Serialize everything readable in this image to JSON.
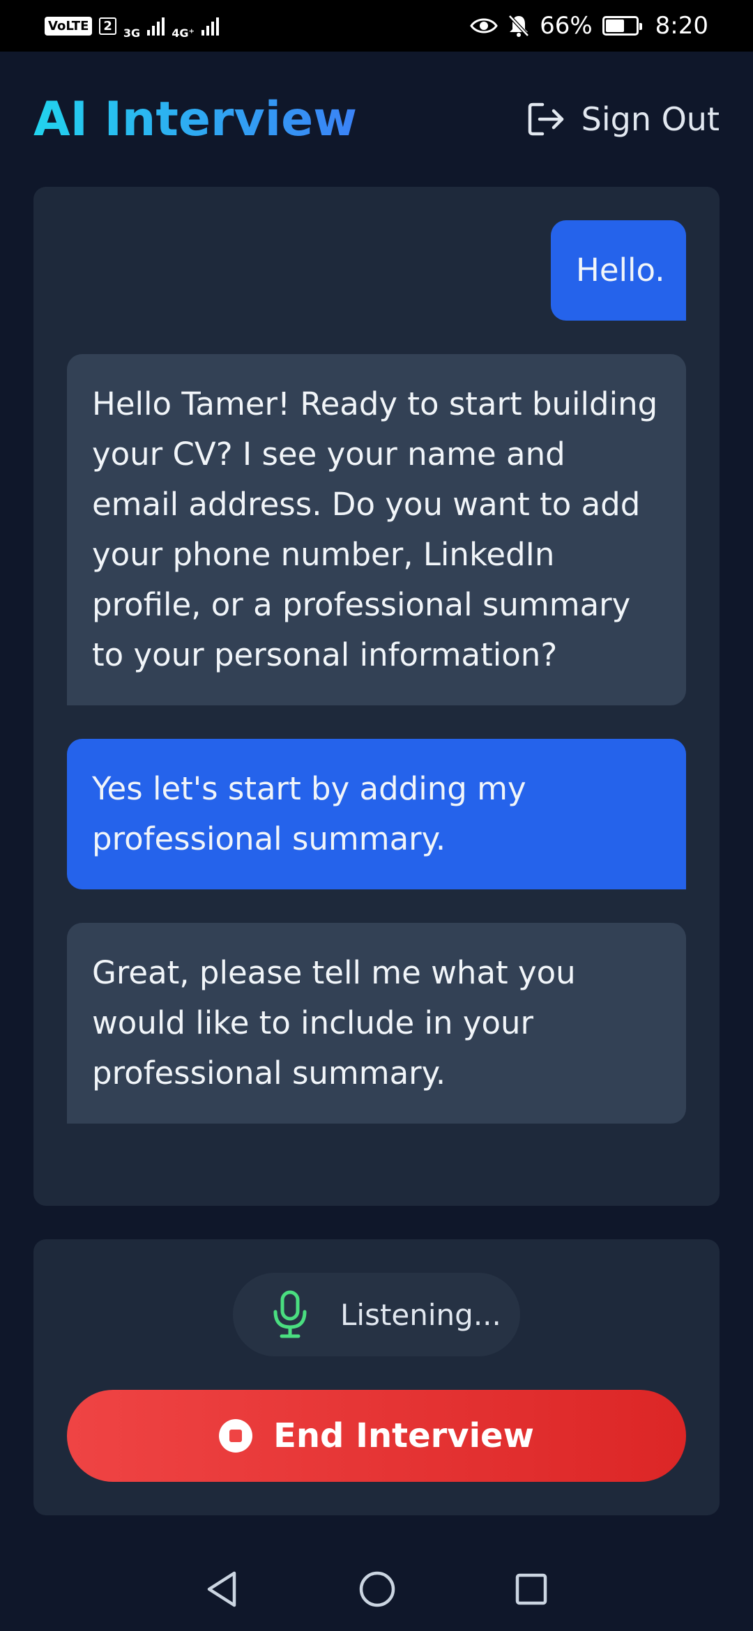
{
  "status_bar": {
    "volte": "VoLTE",
    "sim": "2",
    "net1": "3G",
    "net2": "4G⁺",
    "battery_percent": "66%",
    "battery_level": 0.66,
    "time": "8:20"
  },
  "header": {
    "title": "AI Interview",
    "sign_out_label": "Sign Out"
  },
  "chat": {
    "messages": [
      {
        "role": "user",
        "text": "Hello."
      },
      {
        "role": "ai",
        "text": "Hello Tamer! Ready to start building your CV? I see your name and email address. Do you want to add your phone number, LinkedIn profile, or a professional summary to your personal information?"
      },
      {
        "role": "user",
        "text": "Yes let's start by adding my professional summary."
      },
      {
        "role": "ai",
        "text": "Great, please tell me what you would like to include in your professional summary."
      }
    ]
  },
  "controls": {
    "listening_label": "Listening...",
    "end_button_label": "End Interview"
  },
  "colors": {
    "background": "#0f172a",
    "panel": "#1e293b",
    "user_bubble": "#2563eb",
    "ai_bubble": "#334155",
    "mic_green": "#4ade80",
    "end_red": "#ef4444",
    "title_gradient_start": "#22d3ee",
    "title_gradient_end": "#3b82f6"
  },
  "icons": {
    "sign_out": "sign-out-icon",
    "mic": "microphone-icon",
    "stop": "stop-icon",
    "nav_back": "back-triangle-icon",
    "nav_home": "home-circle-icon",
    "nav_recents": "recents-square-icon"
  }
}
